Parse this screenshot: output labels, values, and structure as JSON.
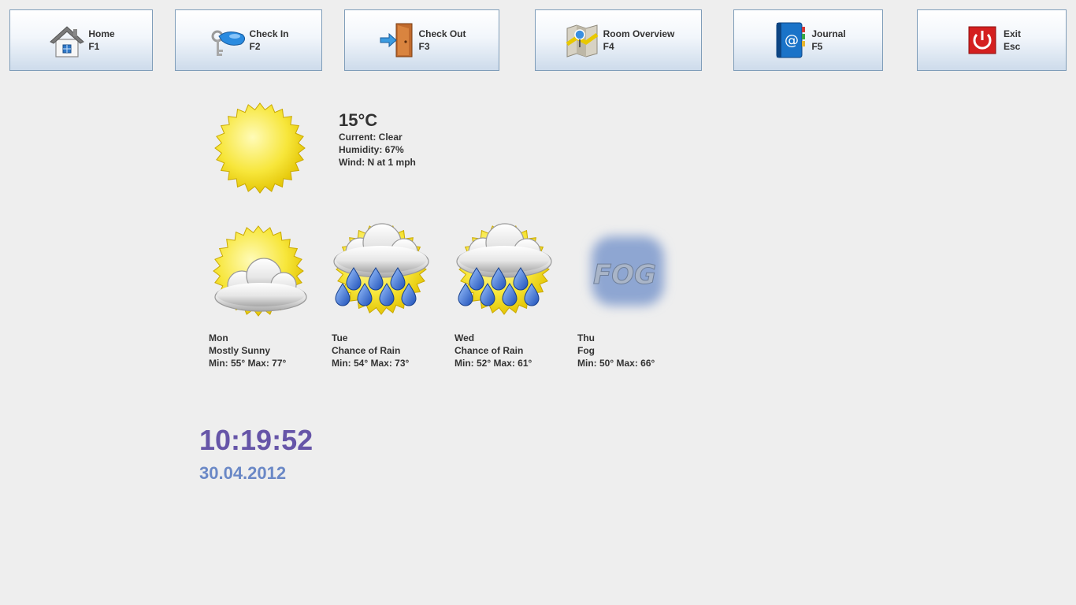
{
  "toolbar": {
    "home": {
      "label": "Home",
      "key": "F1"
    },
    "checkin": {
      "label": "Check In",
      "key": "F2"
    },
    "checkout": {
      "label": "Check Out",
      "key": "F3"
    },
    "rooms": {
      "label": "Room Overview",
      "key": "F4"
    },
    "journal": {
      "label": "Journal",
      "key": "F5"
    },
    "exit": {
      "label": "Exit",
      "key": "Esc"
    }
  },
  "current": {
    "icon": "sun-icon",
    "temp": "15°C",
    "condition": "Current: Clear",
    "humidity": "Humidity: 67%",
    "wind": "Wind: N at 1 mph"
  },
  "forecast": [
    {
      "icon": "mostly-sunny-icon",
      "day": "Mon",
      "condition": "Mostly Sunny",
      "range": "Min: 55° Max: 77°"
    },
    {
      "icon": "chance-of-rain-icon",
      "day": "Tue",
      "condition": "Chance of Rain",
      "range": "Min: 54° Max: 73°"
    },
    {
      "icon": "chance-of-rain-icon",
      "day": "Wed",
      "condition": "Chance of Rain",
      "range": "Min: 52° Max: 61°"
    },
    {
      "icon": "fog-icon",
      "day": "Thu",
      "condition": "Fog",
      "range": "Min: 50° Max: 66°",
      "icon_text": "FOG"
    }
  ],
  "clock": {
    "time": "10:19:52",
    "date": "30.04.2012"
  },
  "colors": {
    "time": "#6655a8",
    "date": "#6a88c6",
    "button_border": "#7f9db9",
    "background": "#eeeeee"
  }
}
